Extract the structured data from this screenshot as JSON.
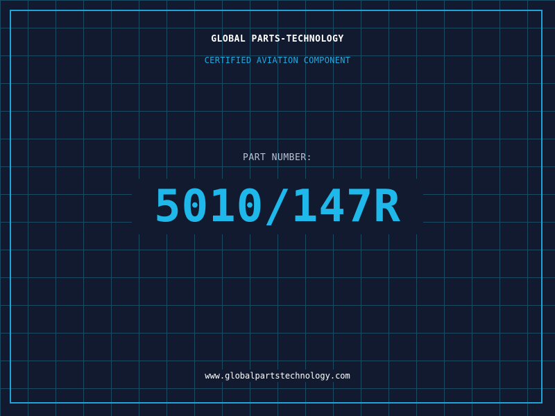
{
  "brand": {
    "name": "GLOBAL PARTS-TECHNOLOGY",
    "tagline": "CERTIFIED AVIATION COMPONENT"
  },
  "part": {
    "label": "PART NUMBER:",
    "number": "5010/147R"
  },
  "footer": {
    "url": "www.globalpartstechnology.com"
  },
  "colors": {
    "background": "#111a2e",
    "grid": "#1d4a63",
    "accent": "#1fb8ea",
    "text": "#ffffff",
    "muted": "#b7c2d3"
  }
}
